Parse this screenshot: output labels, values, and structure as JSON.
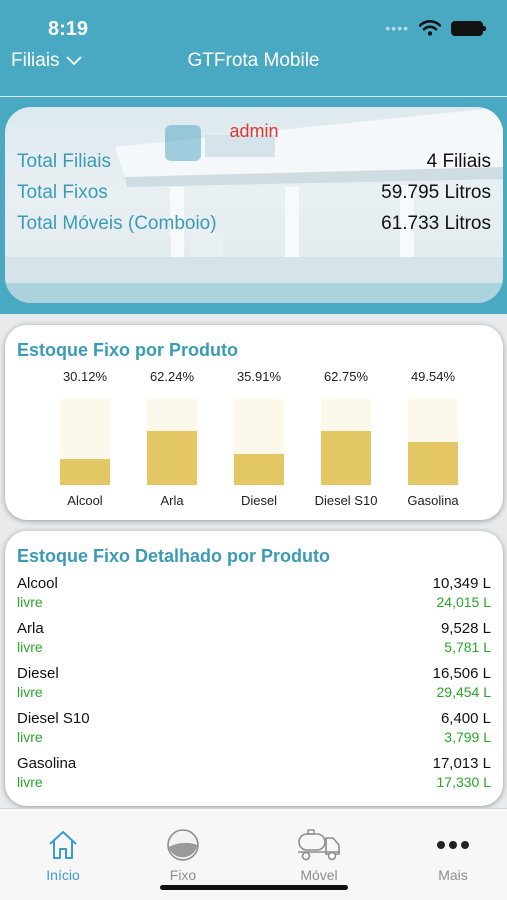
{
  "status": {
    "time": "8:19"
  },
  "nav": {
    "left_label": "Filiais",
    "title": "GTFrota Mobile"
  },
  "summary": {
    "user": "admin",
    "rows": [
      {
        "label": "Total Filiais",
        "value": "4 Filiais"
      },
      {
        "label": "Total Fixos",
        "value": "59.795 Litros"
      },
      {
        "label": "Total Móveis (Comboio)",
        "value": "61.733 Litros"
      }
    ]
  },
  "stock_chart": {
    "title": "Estoque Fixo por Produto"
  },
  "chart_data": {
    "type": "bar",
    "categories": [
      "Alcool",
      "Arla",
      "Diesel",
      "Diesel S10",
      "Gasolina"
    ],
    "value_labels": [
      "30.12%",
      "62.24%",
      "35.91%",
      "62.75%",
      "49.54%"
    ],
    "values": [
      30.12,
      62.24,
      35.91,
      62.75,
      49.54
    ],
    "ylim": [
      0,
      100
    ],
    "colors": {
      "fill": "#e3c764",
      "track": "#fcf8ea"
    }
  },
  "detail": {
    "title": "Estoque Fixo Detalhado por Produto",
    "products": [
      {
        "name": "Alcool",
        "amount": "10,349 L",
        "free_label": "livre",
        "free": "24,015 L"
      },
      {
        "name": "Arla",
        "amount": "9,528 L",
        "free_label": "livre",
        "free": "5,781 L"
      },
      {
        "name": "Diesel",
        "amount": "16,506 L",
        "free_label": "livre",
        "free": "29,454 L"
      },
      {
        "name": "Diesel S10",
        "amount": "6,400 L",
        "free_label": "livre",
        "free": "3,799 L"
      },
      {
        "name": "Gasolina",
        "amount": "17,013 L",
        "free_label": "livre",
        "free": "17,330 L"
      }
    ]
  },
  "tabs": [
    {
      "label": "Início",
      "icon": "home-icon",
      "active": true
    },
    {
      "label": "Fixo",
      "icon": "tank-gauge-icon",
      "active": false
    },
    {
      "label": "Móvel",
      "icon": "tanker-truck-icon",
      "active": false
    },
    {
      "label": "Mais",
      "icon": "more-dots-icon",
      "active": false
    }
  ],
  "colors": {
    "accent": "#4aa9c2",
    "label_blue": "#3b9bb7",
    "admin_red": "#e0342f",
    "free_green": "#2aa52a",
    "tab_active": "#3b9bd1"
  }
}
